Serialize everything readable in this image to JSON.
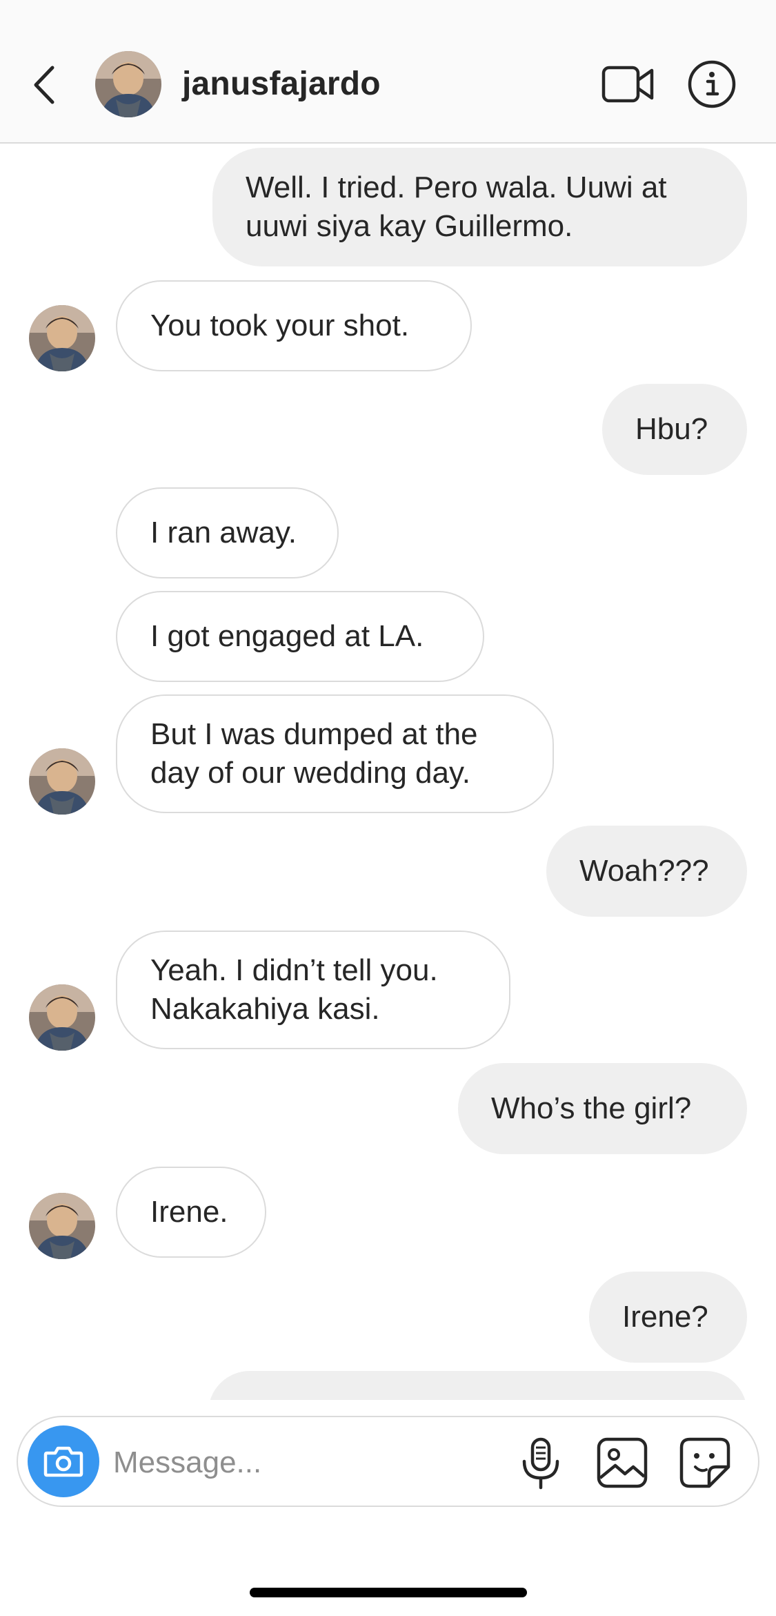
{
  "header": {
    "username": "janusfajardo",
    "back_icon": "chevron-left-icon",
    "video_icon": "video-call-icon",
    "info_icon": "info-icon"
  },
  "messages": [
    {
      "from": "me",
      "text_lines": [
        "Well. I tried. Pero wala. Uuwi at",
        "uuwi siya kay Guillermo."
      ]
    },
    {
      "from": "them",
      "text_lines": [
        "You took your shot."
      ]
    },
    {
      "from": "me",
      "text_lines": [
        "Hbu?"
      ]
    },
    {
      "from": "them",
      "text_lines": [
        "I ran away."
      ]
    },
    {
      "from": "them",
      "text_lines": [
        "I got engaged at LA."
      ]
    },
    {
      "from": "them",
      "text_lines": [
        "But I was dumped at the",
        "day of our wedding day."
      ]
    },
    {
      "from": "me",
      "text_lines": [
        "Woah???"
      ]
    },
    {
      "from": "them",
      "text_lines": [
        "Yeah. I didn’t tell you.",
        "Nakakahiya kasi."
      ]
    },
    {
      "from": "me",
      "text_lines": [
        "Who’s the girl?"
      ]
    },
    {
      "from": "them",
      "text_lines": [
        "Irene."
      ]
    },
    {
      "from": "me",
      "text_lines": [
        "Irene?"
      ]
    }
  ],
  "composer": {
    "placeholder": "Message...",
    "camera_icon": "camera-icon",
    "mic_icon": "microphone-icon",
    "gallery_icon": "gallery-icon",
    "sticker_icon": "sticker-icon"
  },
  "colors": {
    "accent": "#3897f0",
    "outgoing_bubble": "#efefef",
    "incoming_border": "#dbdbdb",
    "text": "#262626",
    "placeholder": "#8e8e8e"
  }
}
